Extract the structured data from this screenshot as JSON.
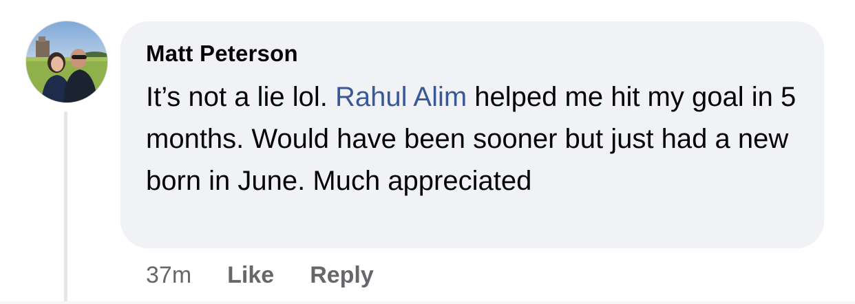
{
  "comment": {
    "author": "Matt Peterson",
    "text_before_mention": "It’s not a lie lol. ",
    "mention": "Rahul Alim",
    "text_after_mention": " helped me hit my goal in 5 months. Would have been sooner but just had a new born in June. Much appreciated",
    "timestamp": "37m",
    "like_label": "Like",
    "reply_label": "Reply"
  },
  "colors": {
    "bubble_bg": "#f0f2f5",
    "mention": "#385898",
    "meta_text": "#65676b",
    "body_text": "#050505"
  },
  "icons": {
    "avatar": "profile-photo-avatar"
  }
}
